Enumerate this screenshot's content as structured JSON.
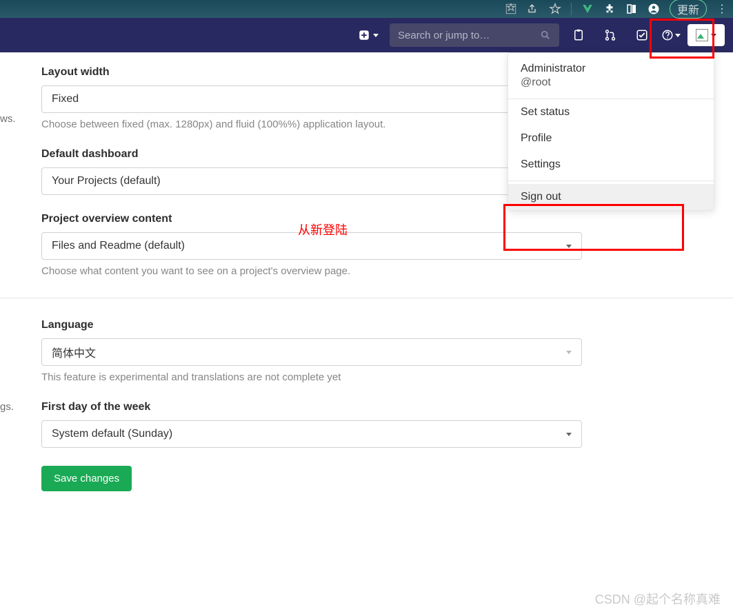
{
  "browser": {
    "update_label": "更新"
  },
  "navbar": {
    "search_placeholder": "Search or jump to…"
  },
  "dropdown": {
    "display_name": "Administrator",
    "username": "@root",
    "items": {
      "set_status": "Set status",
      "profile": "Profile",
      "settings": "Settings",
      "sign_out": "Sign out"
    }
  },
  "annotation": {
    "relogin": "从新登陆"
  },
  "side_fragments": {
    "ws": "ws.",
    "gs": "gs."
  },
  "form": {
    "layout_width": {
      "label": "Layout width",
      "value": "Fixed",
      "hint": "Choose between fixed (max. 1280px) and fluid (100%%) application layout."
    },
    "default_dashboard": {
      "label": "Default dashboard",
      "value": "Your Projects (default)"
    },
    "project_overview": {
      "label": "Project overview content",
      "value": "Files and Readme (default)",
      "hint": "Choose what content you want to see on a project's overview page."
    },
    "language": {
      "label": "Language",
      "value": "简体中文",
      "hint": "This feature is experimental and translations are not complete yet"
    },
    "first_day": {
      "label": "First day of the week",
      "value": "System default (Sunday)"
    },
    "save_label": "Save changes"
  },
  "watermark": "CSDN @起个名称真难"
}
